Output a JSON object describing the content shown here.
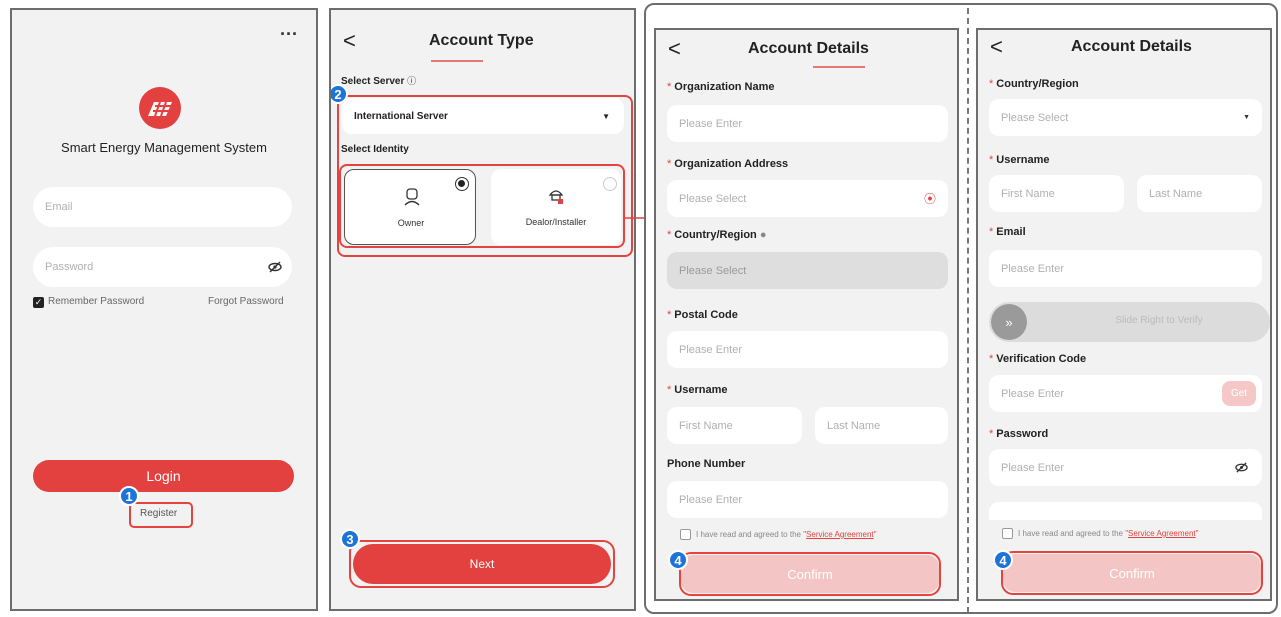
{
  "screen1": {
    "menu": "···",
    "app_name": "Smart Energy Management System",
    "email_placeholder": "Email",
    "password_placeholder": "Password",
    "remember": "Remember Password",
    "forgot": "Forgot Password",
    "login": "Login",
    "register": "Register",
    "badge": "1",
    "icons": [
      "brand-logo-icon",
      "eye-slash-icon",
      "menu-dots-icon"
    ],
    "colors": {
      "brand": "#e34040",
      "badge": "#1c74d8"
    }
  },
  "screen2": {
    "back": "<",
    "title": "Account Type",
    "select_server": "Select Server",
    "server_value": "International Server",
    "select_identity": "Select Identity",
    "owner": "Owner",
    "dealer": "Dealor/Installer",
    "next": "Next",
    "badge2": "2",
    "badge3": "3"
  },
  "screen3": {
    "back": "<",
    "title": "Account Details",
    "org_name": "Organization Name",
    "org_name_ph": "Please Enter",
    "org_addr": "Organization Address",
    "org_addr_ph": "Please Select",
    "country": "Country/Region",
    "country_ph": "Please Select",
    "postal": "Postal Code",
    "postal_ph": "Please Enter",
    "username": "Username",
    "first": "First Name",
    "last": "Last Name",
    "phone": "Phone Number",
    "phone_ph": "Please Enter",
    "agree_prefix": "I have read and agreed to the",
    "agree_link": "Service Agreement",
    "confirm": "Confirm",
    "badge": "4"
  },
  "screen4": {
    "back": "<",
    "title": "Account Details",
    "country": "Country/Region",
    "country_ph": "Please Select",
    "username": "Username",
    "first": "First Name",
    "last": "Last Name",
    "email": "Email",
    "email_ph": "Please Enter",
    "slide": "Slide Right to Verify",
    "vcode": "Verification Code",
    "vcode_ph": "Please Enter",
    "get": "Get",
    "password": "Password",
    "password_ph": "Please Enter",
    "agree_prefix": "I have read and agreed to the",
    "agree_link": "Service Agreement",
    "confirm": "Confirm",
    "badge": "4"
  }
}
